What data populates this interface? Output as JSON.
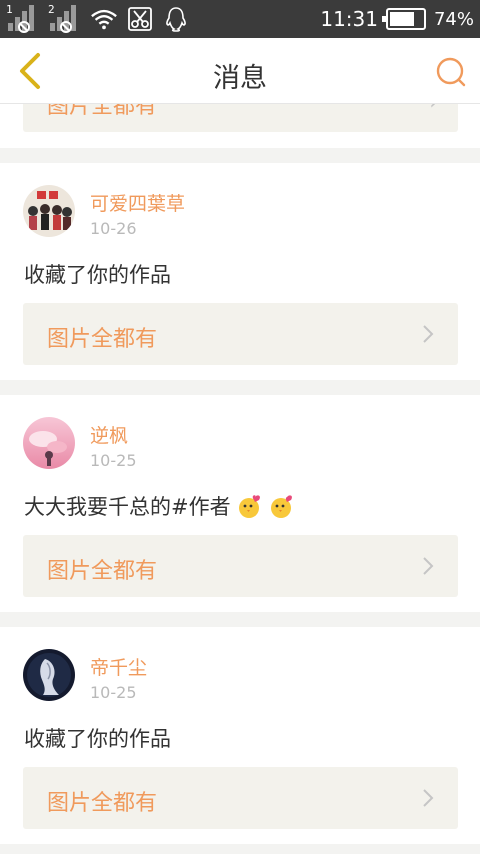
{
  "status_bar": {
    "sim1_label": "1",
    "sim2_label": "2",
    "time": "11:31",
    "battery_percent": "74%",
    "battery_level": 0.74,
    "icons": [
      "signal-icon",
      "signal-icon",
      "wifi-icon",
      "scissors-icon",
      "qq-icon"
    ]
  },
  "header": {
    "title": "消息",
    "back_icon": "chevron-left-icon",
    "search_icon": "search-icon"
  },
  "partial_item": {
    "work_label": "图片全都有"
  },
  "messages": [
    {
      "user": "可爱四葉草",
      "date": "10-26",
      "text": "收藏了你的作品",
      "emoji_count": 0,
      "work_label": "图片全都有"
    },
    {
      "user": "逆枫",
      "date": "10-25",
      "text": "大大我要千总的#作者",
      "emoji_count": 2,
      "work_label": "图片全都有"
    },
    {
      "user": "帝千尘",
      "date": "10-25",
      "text": "收藏了你的作品",
      "emoji_count": 0,
      "work_label": "图片全都有"
    }
  ],
  "colors": {
    "accent": "#f09a5c",
    "back_arrow": "#d9b21a",
    "status_bar": "#3b3b3b",
    "background": "#f3f3f1",
    "work_bg": "#f3f2ec"
  }
}
